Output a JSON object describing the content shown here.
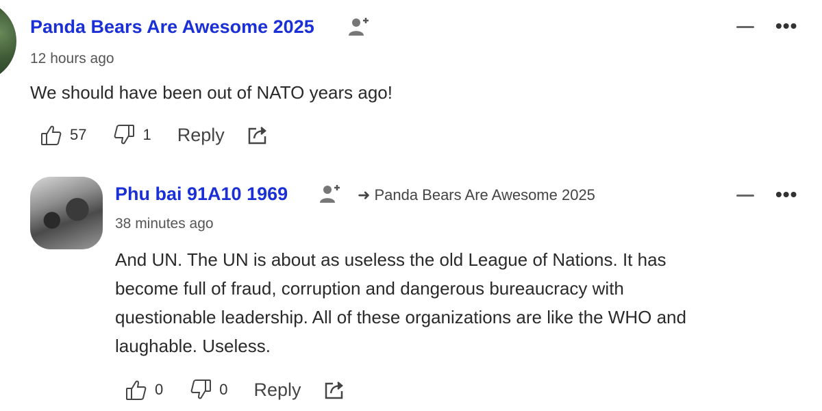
{
  "comments": [
    {
      "username": "Panda Bears Are Awesome 2025",
      "timestamp": "12 hours ago",
      "body": "We should have been out of NATO years ago!",
      "likes": "57",
      "dislikes": "1",
      "reply_label": "Reply"
    },
    {
      "username": "Phu bai 91A10 1969",
      "reply_to": "Panda Bears Are Awesome 2025",
      "timestamp": "38 minutes ago",
      "body_lines": [
        "And UN. The UN is about as useless the old League of Nations. It has",
        "become full of fraud, corruption and dangerous bureaucracy with",
        "questionable leadership. All of these organizations are like the WHO and",
        "laughable. Useless."
      ],
      "likes": "0",
      "dislikes": "0",
      "reply_label": "Reply"
    }
  ],
  "icons": {
    "follow": "user-plus-icon",
    "like": "thumbs-up-icon",
    "dislike": "thumbs-down-icon",
    "share": "share-icon",
    "more": "more-horizontal-icon",
    "collapse": "minus-icon",
    "reply_arrow": "arrow-right-icon"
  },
  "colors": {
    "username": "#1a2fd6",
    "text": "#2a2a2a",
    "muted": "#555555"
  }
}
